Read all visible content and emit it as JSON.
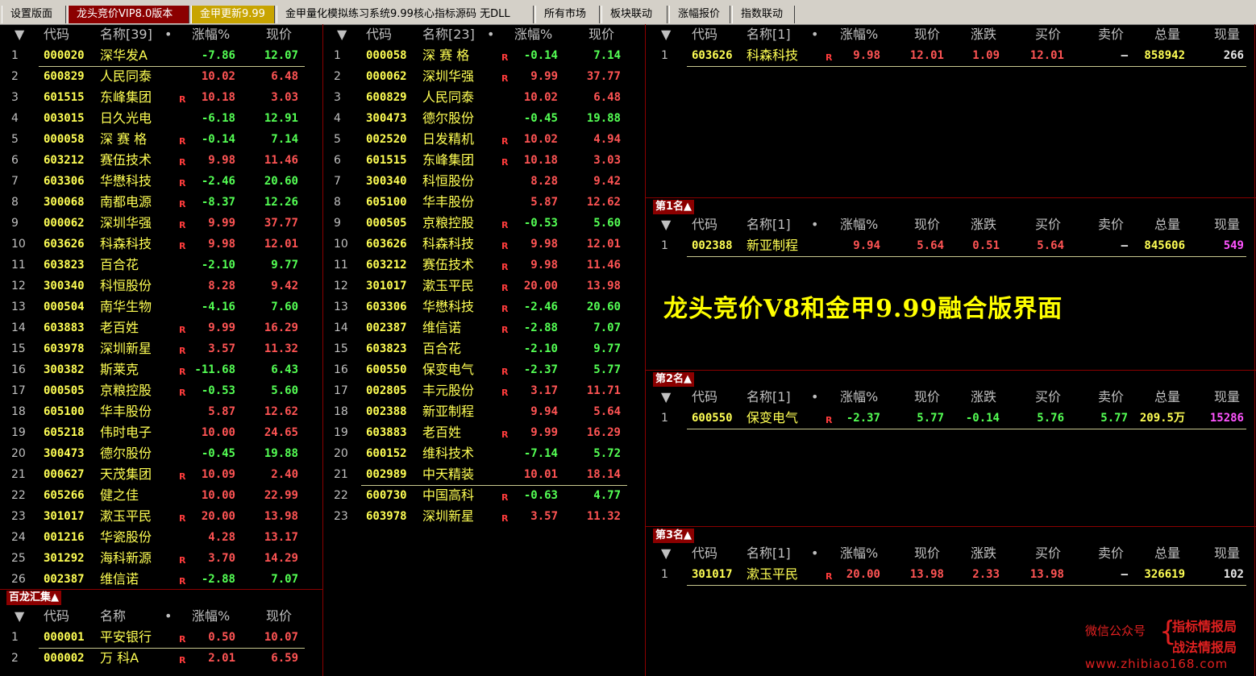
{
  "tabs": [
    {
      "label": "设置版面",
      "state": "normal"
    },
    {
      "label": "龙头竞价VIP8.0版本",
      "state": "active"
    },
    {
      "label": "金甲更新9.99",
      "state": "gold"
    },
    {
      "label": "金甲量化模拟练习系统9.99核心指标源码 无DLL",
      "state": "normal"
    },
    {
      "label": "所有市场",
      "state": "normal"
    },
    {
      "label": "板块联动",
      "state": "normal"
    },
    {
      "label": "涨幅报价",
      "state": "normal"
    },
    {
      "label": "指数联动",
      "state": "normal"
    }
  ],
  "list1": {
    "headers": {
      "sort": "▼",
      "code": "代码",
      "name": "名称[39]",
      "dot": "•",
      "chg": "涨幅%",
      "price": "现价"
    },
    "rows": [
      {
        "i": "1",
        "code": "000020",
        "name": "深华发A",
        "r": "",
        "chg": "-7.86",
        "price": "12.07",
        "dir": "dn"
      },
      {
        "i": "2",
        "code": "600829",
        "name": "人民同泰",
        "r": "",
        "chg": "10.02",
        "price": "6.48",
        "dir": "up"
      },
      {
        "i": "3",
        "code": "601515",
        "name": "东峰集团",
        "r": "R",
        "chg": "10.18",
        "price": "3.03",
        "dir": "up"
      },
      {
        "i": "4",
        "code": "003015",
        "name": "日久光电",
        "r": "",
        "chg": "-6.18",
        "price": "12.91",
        "dir": "dn"
      },
      {
        "i": "5",
        "code": "000058",
        "name": "深 赛 格",
        "r": "R",
        "chg": "-0.14",
        "price": "7.14",
        "dir": "dn"
      },
      {
        "i": "6",
        "code": "603212",
        "name": "赛伍技术",
        "r": "R",
        "chg": "9.98",
        "price": "11.46",
        "dir": "up"
      },
      {
        "i": "7",
        "code": "603306",
        "name": "华懋科技",
        "r": "R",
        "chg": "-2.46",
        "price": "20.60",
        "dir": "dn"
      },
      {
        "i": "8",
        "code": "300068",
        "name": "南都电源",
        "r": "R",
        "chg": "-8.37",
        "price": "12.26",
        "dir": "dn"
      },
      {
        "i": "9",
        "code": "000062",
        "name": "深圳华强",
        "r": "R",
        "chg": "9.99",
        "price": "37.77",
        "dir": "up"
      },
      {
        "i": "10",
        "code": "603626",
        "name": "科森科技",
        "r": "R",
        "chg": "9.98",
        "price": "12.01",
        "dir": "up"
      },
      {
        "i": "11",
        "code": "603823",
        "name": "百合花",
        "r": "",
        "chg": "-2.10",
        "price": "9.77",
        "dir": "dn"
      },
      {
        "i": "12",
        "code": "300340",
        "name": "科恒股份",
        "r": "",
        "chg": "8.28",
        "price": "9.42",
        "dir": "up"
      },
      {
        "i": "13",
        "code": "000504",
        "name": "南华生物",
        "r": "",
        "chg": "-4.16",
        "price": "7.60",
        "dir": "dn"
      },
      {
        "i": "14",
        "code": "603883",
        "name": "老百姓",
        "r": "R",
        "chg": "9.99",
        "price": "16.29",
        "dir": "up"
      },
      {
        "i": "15",
        "code": "603978",
        "name": "深圳新星",
        "r": "R",
        "chg": "3.57",
        "price": "11.32",
        "dir": "up"
      },
      {
        "i": "16",
        "code": "300382",
        "name": "斯莱克",
        "r": "R",
        "chg": "-11.68",
        "price": "6.43",
        "dir": "dn"
      },
      {
        "i": "17",
        "code": "000505",
        "name": "京粮控股",
        "r": "R",
        "chg": "-0.53",
        "price": "5.60",
        "dir": "dn"
      },
      {
        "i": "18",
        "code": "605100",
        "name": "华丰股份",
        "r": "",
        "chg": "5.87",
        "price": "12.62",
        "dir": "up"
      },
      {
        "i": "19",
        "code": "605218",
        "name": "伟时电子",
        "r": "",
        "chg": "10.00",
        "price": "24.65",
        "dir": "up"
      },
      {
        "i": "20",
        "code": "300473",
        "name": "德尔股份",
        "r": "",
        "chg": "-0.45",
        "price": "19.88",
        "dir": "dn"
      },
      {
        "i": "21",
        "code": "000627",
        "name": "天茂集团",
        "r": "R",
        "chg": "10.09",
        "price": "2.40",
        "dir": "up"
      },
      {
        "i": "22",
        "code": "605266",
        "name": "健之佳",
        "r": "",
        "chg": "10.00",
        "price": "22.99",
        "dir": "up"
      },
      {
        "i": "23",
        "code": "301017",
        "name": "漱玉平民",
        "r": "R",
        "chg": "20.00",
        "price": "13.98",
        "dir": "up"
      },
      {
        "i": "24",
        "code": "001216",
        "name": "华瓷股份",
        "r": "",
        "chg": "4.28",
        "price": "13.17",
        "dir": "up"
      },
      {
        "i": "25",
        "code": "301292",
        "name": "海科新源",
        "r": "R",
        "chg": "3.70",
        "price": "14.29",
        "dir": "up"
      },
      {
        "i": "26",
        "code": "002387",
        "name": "维信诺",
        "r": "R",
        "chg": "-2.88",
        "price": "7.07",
        "dir": "dn"
      }
    ]
  },
  "list2": {
    "headers": {
      "sort": "▼",
      "code": "代码",
      "name": "名称[23]",
      "dot": "•",
      "chg": "涨幅%",
      "price": "现价"
    },
    "rows": [
      {
        "i": "1",
        "code": "000058",
        "name": "深 赛 格",
        "r": "R",
        "chg": "-0.14",
        "price": "7.14",
        "dir": "dn"
      },
      {
        "i": "2",
        "code": "000062",
        "name": "深圳华强",
        "r": "R",
        "chg": "9.99",
        "price": "37.77",
        "dir": "up"
      },
      {
        "i": "3",
        "code": "600829",
        "name": "人民同泰",
        "r": "",
        "chg": "10.02",
        "price": "6.48",
        "dir": "up"
      },
      {
        "i": "4",
        "code": "300473",
        "name": "德尔股份",
        "r": "",
        "chg": "-0.45",
        "price": "19.88",
        "dir": "dn"
      },
      {
        "i": "5",
        "code": "002520",
        "name": "日发精机",
        "r": "R",
        "chg": "10.02",
        "price": "4.94",
        "dir": "up"
      },
      {
        "i": "6",
        "code": "601515",
        "name": "东峰集团",
        "r": "R",
        "chg": "10.18",
        "price": "3.03",
        "dir": "up"
      },
      {
        "i": "7",
        "code": "300340",
        "name": "科恒股份",
        "r": "",
        "chg": "8.28",
        "price": "9.42",
        "dir": "up"
      },
      {
        "i": "8",
        "code": "605100",
        "name": "华丰股份",
        "r": "",
        "chg": "5.87",
        "price": "12.62",
        "dir": "up"
      },
      {
        "i": "9",
        "code": "000505",
        "name": "京粮控股",
        "r": "R",
        "chg": "-0.53",
        "price": "5.60",
        "dir": "dn"
      },
      {
        "i": "10",
        "code": "603626",
        "name": "科森科技",
        "r": "R",
        "chg": "9.98",
        "price": "12.01",
        "dir": "up"
      },
      {
        "i": "11",
        "code": "603212",
        "name": "赛伍技术",
        "r": "R",
        "chg": "9.98",
        "price": "11.46",
        "dir": "up"
      },
      {
        "i": "12",
        "code": "301017",
        "name": "漱玉平民",
        "r": "R",
        "chg": "20.00",
        "price": "13.98",
        "dir": "up"
      },
      {
        "i": "13",
        "code": "603306",
        "name": "华懋科技",
        "r": "R",
        "chg": "-2.46",
        "price": "20.60",
        "dir": "dn"
      },
      {
        "i": "14",
        "code": "002387",
        "name": "维信诺",
        "r": "R",
        "chg": "-2.88",
        "price": "7.07",
        "dir": "dn"
      },
      {
        "i": "15",
        "code": "603823",
        "name": "百合花",
        "r": "",
        "chg": "-2.10",
        "price": "9.77",
        "dir": "dn"
      },
      {
        "i": "16",
        "code": "600550",
        "name": "保变电气",
        "r": "R",
        "chg": "-2.37",
        "price": "5.77",
        "dir": "dn"
      },
      {
        "i": "17",
        "code": "002805",
        "name": "丰元股份",
        "r": "R",
        "chg": "3.17",
        "price": "11.71",
        "dir": "up"
      },
      {
        "i": "18",
        "code": "002388",
        "name": "新亚制程",
        "r": "",
        "chg": "9.94",
        "price": "5.64",
        "dir": "up"
      },
      {
        "i": "19",
        "code": "603883",
        "name": "老百姓",
        "r": "R",
        "chg": "9.99",
        "price": "16.29",
        "dir": "up"
      },
      {
        "i": "20",
        "code": "600152",
        "name": "维科技术",
        "r": "",
        "chg": "-7.14",
        "price": "5.72",
        "dir": "dn"
      },
      {
        "i": "21",
        "code": "002989",
        "name": "中天精装",
        "r": "",
        "chg": "10.01",
        "price": "18.14",
        "dir": "up"
      },
      {
        "i": "22",
        "code": "600730",
        "name": "中国高科",
        "r": "R",
        "chg": "-0.63",
        "price": "4.77",
        "dir": "dn"
      },
      {
        "i": "23",
        "code": "603978",
        "name": "深圳新星",
        "r": "R",
        "chg": "3.57",
        "price": "11.32",
        "dir": "up"
      }
    ]
  },
  "bailong": {
    "title": "百龙汇集▲",
    "headers": {
      "sort": "▼",
      "code": "代码",
      "name": "名称",
      "dot": "•",
      "chg": "涨幅%",
      "price": "现价"
    },
    "rows": [
      {
        "i": "1",
        "code": "000001",
        "name": "平安银行",
        "r": "R",
        "chg": "0.50",
        "price": "10.07",
        "dir": "up"
      },
      {
        "i": "2",
        "code": "000002",
        "name": "万 科A",
        "r": "R",
        "chg": "2.01",
        "price": "6.59",
        "dir": "up"
      }
    ]
  },
  "quote_headers": {
    "sort": "▼",
    "code": "代码",
    "name": "名称[1]",
    "dot": "•",
    "chg": "涨幅%",
    "price": "现价",
    "diff": "涨跌",
    "bid": "买价",
    "ask": "卖价",
    "total": "总量",
    "cur": "现量"
  },
  "quotes": [
    {
      "title": "",
      "row": {
        "i": "1",
        "code": "603626",
        "name": "科森科技",
        "r": "R",
        "chg": "9.98",
        "price": "12.01",
        "diff": "1.09",
        "bid": "12.01",
        "ask": "—",
        "total": "858942",
        "cur": "266",
        "dir": "up",
        "curcolor": "wht"
      }
    },
    {
      "title": "第1名▲",
      "row": {
        "i": "1",
        "code": "002388",
        "name": "新亚制程",
        "r": "",
        "chg": "9.94",
        "price": "5.64",
        "diff": "0.51",
        "bid": "5.64",
        "ask": "—",
        "total": "845606",
        "cur": "549",
        "dir": "up",
        "curcolor": "mag"
      }
    },
    {
      "title": "第2名▲",
      "row": {
        "i": "1",
        "code": "600550",
        "name": "保变电气",
        "r": "R",
        "chg": "-2.37",
        "price": "5.77",
        "diff": "-0.14",
        "bid": "5.76",
        "ask": "5.77",
        "total": "209.5万",
        "cur": "15286",
        "dir": "dn",
        "curcolor": "mag"
      }
    },
    {
      "title": "第3名▲",
      "row": {
        "i": "1",
        "code": "301017",
        "name": "漱玉平民",
        "r": "R",
        "chg": "20.00",
        "price": "13.98",
        "diff": "2.33",
        "bid": "13.98",
        "ask": "—",
        "total": "326619",
        "cur": "102",
        "dir": "up",
        "curcolor": "wht"
      }
    }
  ],
  "headline": "龙头竞价V8和金甲9.99融合版界面",
  "watermark": {
    "wechat": "微信公众号",
    "brace": "{",
    "name1": "指标情报局",
    "name2": "战法情报局",
    "url": "www.zhibiao168.com"
  },
  "colors": {
    "up": "#ff5454",
    "down": "#54ff54",
    "code": "#ffff54",
    "divider": "#8b0000"
  }
}
